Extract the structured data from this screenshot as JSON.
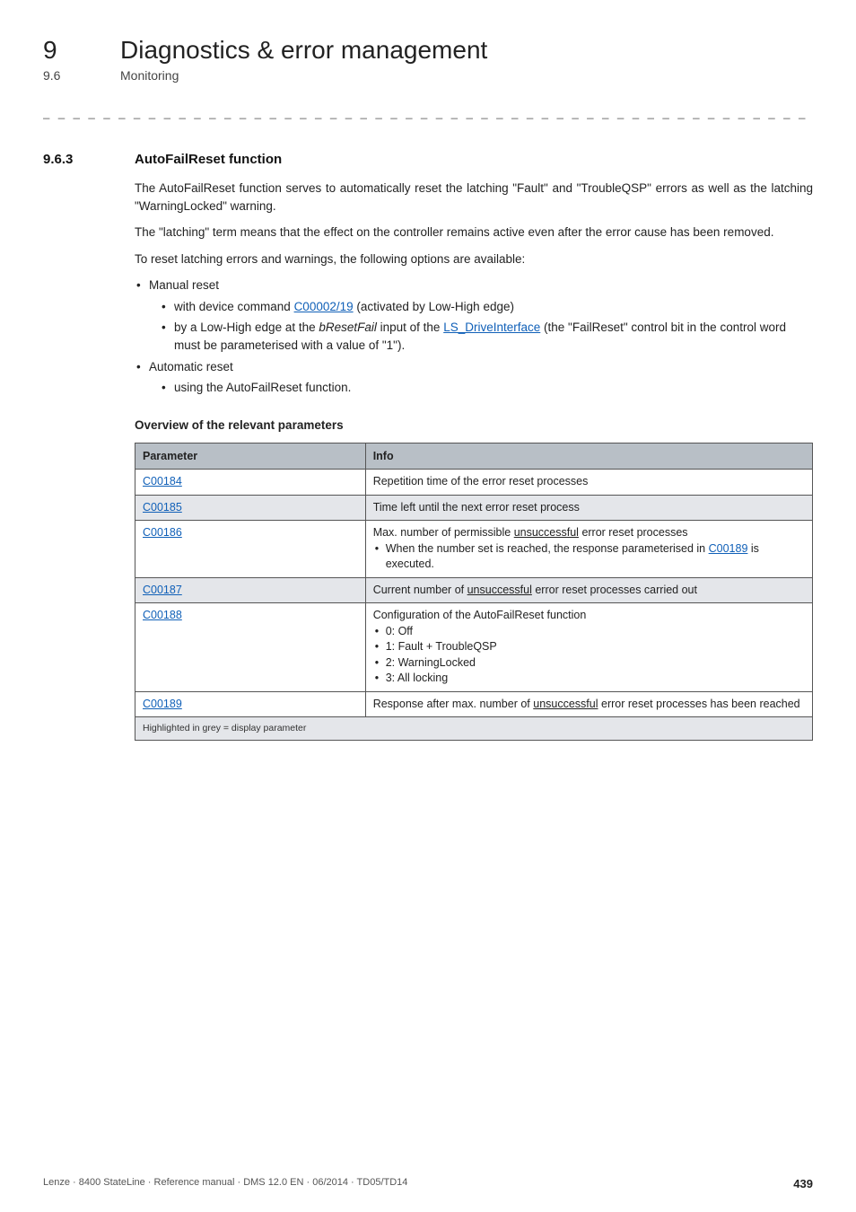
{
  "header": {
    "chapter_num": "9",
    "chapter_title": "Diagnostics & error management",
    "section_num": "9.6",
    "section_title": "Monitoring",
    "dashes": "_ _ _ _ _ _ _ _ _ _ _ _ _ _ _ _ _ _ _ _ _ _ _ _ _ _ _ _ _ _ _ _ _ _ _ _ _ _ _ _ _ _ _ _ _ _ _ _ _ _ _ _ _ _ _ _ _ _ _ _ _ _ _ _"
  },
  "sec": {
    "num": "9.6.3",
    "title": "AutoFailReset function"
  },
  "para": {
    "p1": "The AutoFailReset function serves to automatically reset the latching \"Fault\" and \"TroubleQSP\" errors as well as the latching \"WarningLocked\" warning.",
    "p2": "The \"latching\" term means that the effect on the controller remains active even after the error cause has been removed.",
    "p3": "To reset latching errors and warnings, the following options are available:"
  },
  "list": {
    "manual": "Manual reset",
    "manual_a_pre": "with device command ",
    "manual_a_link": "C00002/19",
    "manual_a_post": " (activated by Low-High edge)",
    "manual_b_pre": "by a Low-High edge at the ",
    "manual_b_it": "bResetFail",
    "manual_b_mid": " input of the ",
    "manual_b_link": "LS_DriveInterface",
    "manual_b_post": " (the \"FailReset\" control bit in the control word must be parameterised with a value of \"1\").",
    "auto": "Automatic reset",
    "auto_a": "using the AutoFailReset function."
  },
  "subheading": "Overview of the relevant parameters",
  "table": {
    "head_param": "Parameter",
    "head_info": "Info",
    "rows": [
      {
        "param": "C00184",
        "info_main": "Repetition time of the error reset processes",
        "subs": []
      },
      {
        "param": "C00185",
        "shaded": true,
        "info_main": "Time left until the next error reset process",
        "subs": []
      },
      {
        "param": "C00186",
        "info_main_pre": "Max. number of permissible ",
        "info_main_u": "unsuccessful",
        "info_main_post": " error reset processes",
        "subs": [
          {
            "pre": "When the number set is reached, the response parameterised in ",
            "link": "C00189",
            "post": " is executed."
          }
        ]
      },
      {
        "param": "C00187",
        "shaded": true,
        "info_main_pre": "Current number of ",
        "info_main_u": "unsuccessful",
        "info_main_post": " error reset processes carried out",
        "subs": []
      },
      {
        "param": "C00188",
        "info_main": "Configuration of the AutoFailReset function",
        "subs": [
          {
            "text": "0: Off"
          },
          {
            "text": "1: Fault + TroubleQSP"
          },
          {
            "text": "2: WarningLocked"
          },
          {
            "text": "3: All locking"
          }
        ]
      },
      {
        "param": "C00189",
        "info_main_pre": "Response after max. number of ",
        "info_main_u": "unsuccessful",
        "info_main_post": " error reset processes has been reached",
        "subs": []
      }
    ],
    "footnote": "Highlighted in grey = display parameter"
  },
  "footer": {
    "ref": "Lenze · 8400 StateLine · Reference manual · DMS 12.0 EN · 06/2014 · TD05/TD14",
    "page": "439"
  }
}
